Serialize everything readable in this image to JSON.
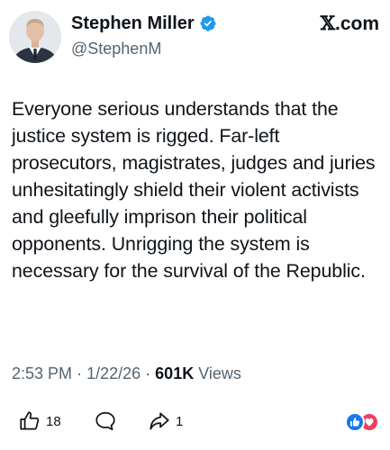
{
  "post": {
    "author_name": "Stephen Miller",
    "author_handle": "@StephenM",
    "source_brand": "X.com",
    "source_brand_x": "𝕏",
    "source_brand_rest": ".com",
    "verified": true,
    "text": "Everyone serious understands that the justice system is rigged. Far-left prosecutors, magistrates, judges and juries unhesitatingly shield their violent activists and gleefully imprison their political opponents. Unrigging the system is necessary for the survival of the Republic.",
    "time": "2:53 PM",
    "separator": "·",
    "date": "1/22/26",
    "views_count": "601K",
    "views_label": "Views"
  },
  "actions": {
    "like_count": "18",
    "share_count": "1"
  },
  "icons": {
    "verified": "verified-badge-icon",
    "like": "thumbs-up-icon",
    "comment": "comment-bubble-icon",
    "share": "share-arrow-icon",
    "reaction_like": "facebook-like-reaction-icon",
    "reaction_love": "facebook-love-reaction-icon"
  },
  "colors": {
    "verified_blue": "#1d9bf0",
    "secondary_text": "#536471",
    "reaction_like": "#1877f2",
    "reaction_love": "#f33e58"
  }
}
